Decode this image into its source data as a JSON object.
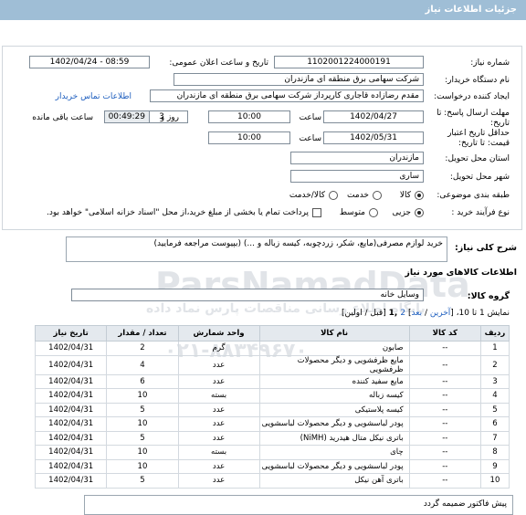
{
  "header": {
    "title": "جزئیات اطلاعات نیاز"
  },
  "form": {
    "need_number_label": "شماره نیاز:",
    "need_number": "1102001224000191",
    "announce_label": "تاریخ و ساعت اعلان عمومی:",
    "announce_value": "1402/04/24 - 08:59",
    "buyer_org_label": "نام دستگاه خریدار:",
    "buyer_org": "شرکت سهامی برق منطقه ای مازندران",
    "creator_label": "ایجاد کننده درخواست:",
    "creator": "مقدم رضازاده قاجاری کارپرداز شرکت سهامی برق منطقه ای مازندران",
    "contact_link": "اطلاعات تماس خریدار",
    "reply_deadline_label": "مهلت ارسال پاسخ: تا تاریخ:",
    "reply_date": "1402/04/27",
    "time_label": "ساعت",
    "reply_time": "10:00",
    "days_value": "3",
    "days_label": "روز و",
    "remaining_time": "00:49:29",
    "remaining_label": "ساعت باقی مانده",
    "min_validity_label": "حداقل تاریخ اعتبار قیمت: تا تاریخ:",
    "validity_date": "1402/05/31",
    "validity_time": "10:00",
    "province_label": "استان محل تحویل:",
    "province": "مازندران",
    "city_label": "شهر محل تحویل:",
    "city": "ساری",
    "category_label": "طبقه بندی موضوعی:",
    "category_options": [
      "کالا",
      "خدمت",
      "کالا/خدمت"
    ],
    "purchase_label": "نوع فرآیند خرید :",
    "purchase_options": [
      "جزیی",
      "متوسط"
    ],
    "payment_note": "پرداخت تمام یا بخشی از مبلغ خرید،از محل \"اسناد خزانه اسلامی\" خواهد بود."
  },
  "description": {
    "label": "شرح کلی نیاز:",
    "text": "خرید لوازم مصرفی(مایع، شکر، زردچوبه، کیسه زباله و ...) (بپیوست مراجعه فرمایید)"
  },
  "goods": {
    "title": "اطلاعات کالاهای مورد نیاز",
    "group_label": "گروه کالا:",
    "group_value": "وسایل خانه",
    "pager_prefix": "نمایش 1 تا 10، [",
    "pager_last": "آخرین",
    "pager_sep1": " / ",
    "pager_next": "بعد",
    "pager_mid": "] ",
    "pager_page2": "2",
    "pager_current": " ,1",
    "pager_rest": " [قبل / اولین]",
    "columns": [
      "ردیف",
      "کد کالا",
      "نام کالا",
      "واحد شمارش",
      "تعداد / مقدار",
      "تاریخ نیاز"
    ],
    "rows": [
      [
        "1",
        "--",
        "صابون",
        "گرم",
        "2",
        "1402/04/31"
      ],
      [
        "2",
        "--",
        "مایع ظرفشویی و دیگر محصولات ظرفشویی",
        "عدد",
        "4",
        "1402/04/31"
      ],
      [
        "3",
        "--",
        "مایع سفید کننده",
        "عدد",
        "6",
        "1402/04/31"
      ],
      [
        "4",
        "--",
        "کیسه زباله",
        "بسته",
        "10",
        "1402/04/31"
      ],
      [
        "5",
        "--",
        "کیسه پلاستیکی",
        "عدد",
        "5",
        "1402/04/31"
      ],
      [
        "6",
        "--",
        "پودر لباسشویی و دیگر محصولات لباسشویی",
        "عدد",
        "10",
        "1402/04/31"
      ],
      [
        "7",
        "--",
        "باتری نیکل متال هیدرید (NiMH)",
        "عدد",
        "5",
        "1402/04/31"
      ],
      [
        "8",
        "--",
        "چای",
        "بسته",
        "10",
        "1402/04/31"
      ],
      [
        "9",
        "--",
        "پودر لباسشویی و دیگر محصولات لباسشویی",
        "عدد",
        "10",
        "1402/04/31"
      ],
      [
        "10",
        "--",
        "باتری آهن نیکل",
        "عدد",
        "5",
        "1402/04/31"
      ]
    ]
  },
  "footer": {
    "text": "پیش فاکتور ضمیمه گردد"
  },
  "watermark": {
    "line1": "ParsNamadData",
    "line2": "پایگاه اطلاع رسانی مناقصات پارس نماد داده",
    "phone": "۰۲۱-۸۸۳۴۹۶۷۰"
  },
  "colors": {
    "topbar": "#9fbed6",
    "link": "#1f5fbf",
    "table_header": "#e4e9ee"
  }
}
